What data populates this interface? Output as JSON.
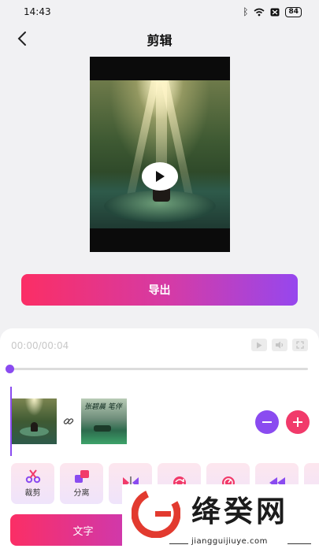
{
  "status_bar": {
    "time": "14:43",
    "battery": "84",
    "icons": [
      "bluetooth-icon",
      "wifi-icon",
      "sim-off-icon",
      "battery-icon"
    ]
  },
  "header": {
    "title": "剪辑",
    "back_icon": "chevron-left-icon"
  },
  "preview": {
    "play_icon": "play-icon"
  },
  "export_button": {
    "label": "导出"
  },
  "editor": {
    "timecode": "00:00/00:04",
    "controls": [
      "play-icon",
      "volume-icon",
      "fullscreen-icon"
    ],
    "progress": 0,
    "clips": [
      {
        "name": "clip-1"
      },
      {
        "name": "clip-2",
        "overlay_text": "张碧晨 笔伴"
      }
    ]
  },
  "tools": [
    {
      "label": "裁剪",
      "icon": "scissors-icon"
    },
    {
      "label": "分离",
      "icon": "split-icon"
    },
    {
      "label": "",
      "icon": "mirror-icon"
    },
    {
      "label": "",
      "icon": "rotate-icon"
    },
    {
      "label": "",
      "icon": "speed-icon"
    },
    {
      "label": "",
      "icon": "rewind-icon"
    },
    {
      "label": "",
      "icon": "more-icon"
    }
  ],
  "text_button": {
    "label": "文字"
  },
  "watermark": {
    "name": "绛癸网",
    "url": "jiangguijiuye.com"
  },
  "colors": {
    "accent_pink": "#fb2e65",
    "accent_purple": "#8a4bf0"
  }
}
